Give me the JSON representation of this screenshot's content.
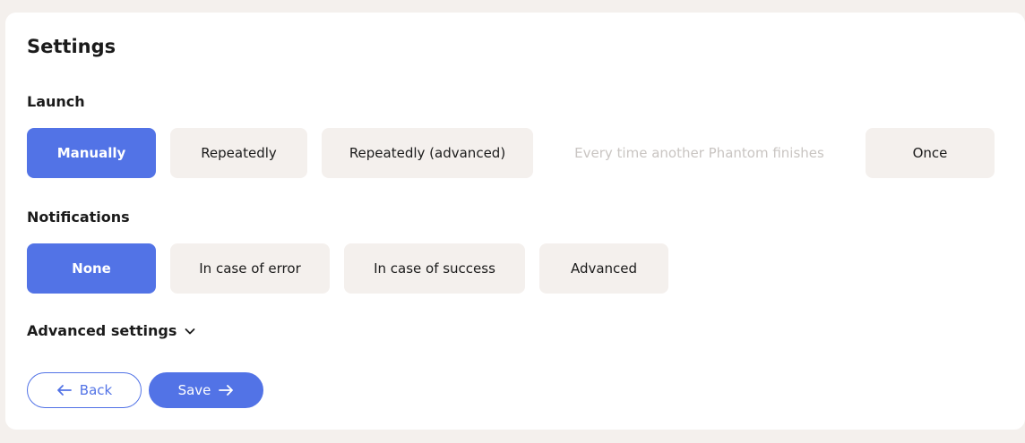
{
  "title": "Settings",
  "launch": {
    "label": "Launch",
    "options": [
      {
        "label": "Manually",
        "state": "selected"
      },
      {
        "label": "Repeatedly",
        "state": "default"
      },
      {
        "label": "Repeatedly (advanced)",
        "state": "default"
      },
      {
        "label": "Every time another Phantom finishes",
        "state": "disabled"
      },
      {
        "label": "Once",
        "state": "default"
      }
    ]
  },
  "notifications": {
    "label": "Notifications",
    "options": [
      {
        "label": "None",
        "state": "selected"
      },
      {
        "label": "In case of error",
        "state": "default"
      },
      {
        "label": "In case of success",
        "state": "default"
      },
      {
        "label": "Advanced",
        "state": "default"
      }
    ]
  },
  "advanced_settings": {
    "label": "Advanced settings",
    "icon": "chevron-down-icon"
  },
  "footer": {
    "back_label": "Back",
    "back_icon": "arrow-left-icon",
    "save_label": "Save",
    "save_icon": "arrow-right-icon"
  },
  "colors": {
    "accent": "#5273e6",
    "option_bg": "#f4f0ed",
    "disabled_text": "#c9c5c2",
    "page_bg": "#f4f0ed"
  }
}
